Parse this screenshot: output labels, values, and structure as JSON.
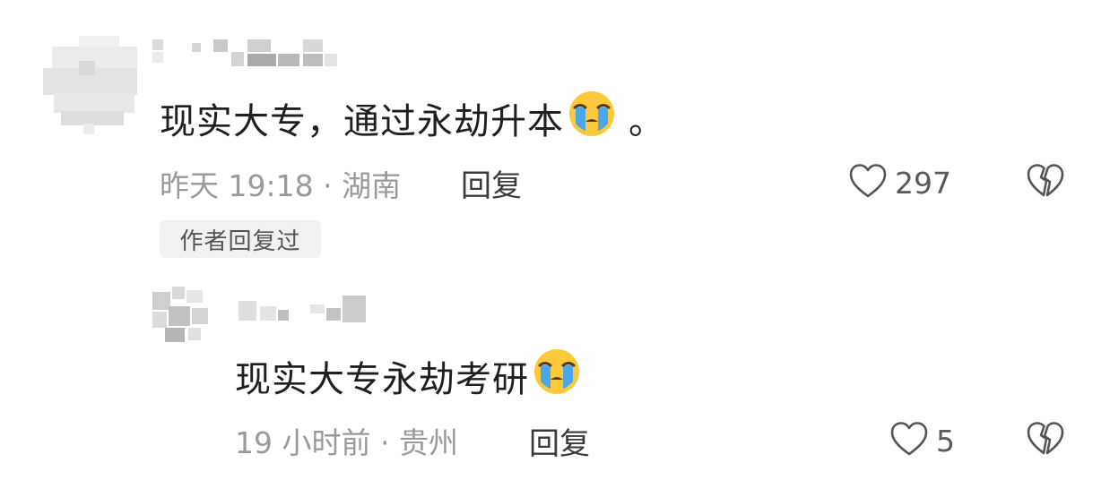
{
  "comments": [
    {
      "text": "现实大专，通过永劫升本",
      "trailing": "。",
      "time": "昨天 19:18",
      "separator": "·",
      "location": "湖南",
      "reply_label": "回复",
      "likes": "297",
      "badge": "作者回复过"
    },
    {
      "text": "现实大专永劫考研",
      "time": "19 小时前",
      "separator": "·",
      "location": "贵州",
      "reply_label": "回复",
      "likes": "5"
    }
  ],
  "icons": {
    "emoji": "loudly-crying-face-emoji",
    "like": "heart-outline-icon",
    "dislike": "broken-heart-icon"
  },
  "colors": {
    "text": "#1f1f1f",
    "meta": "#9a9a9a",
    "badge_bg": "#f1f1f3"
  }
}
